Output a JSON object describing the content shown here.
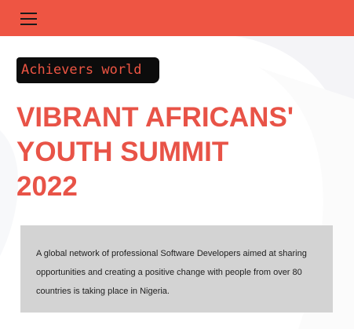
{
  "header": {
    "menu_icon": "hamburger-menu-icon",
    "background_color": "#ee5543"
  },
  "brand": {
    "label": "Achievers world",
    "text_color": "#ee5543",
    "background_color": "#0c0c0c"
  },
  "hero": {
    "title_lines": [
      "VIBRANT AFRICANS'",
      "YOUTH SUMMIT",
      "2022"
    ],
    "title_color": "#e85347"
  },
  "info": {
    "text": "A global network of professional Software Developers aimed at sharing opportunities and creating a positive change with people from over 80 countries is taking place in Nigeria.",
    "background_color": "#d3d3d3"
  }
}
